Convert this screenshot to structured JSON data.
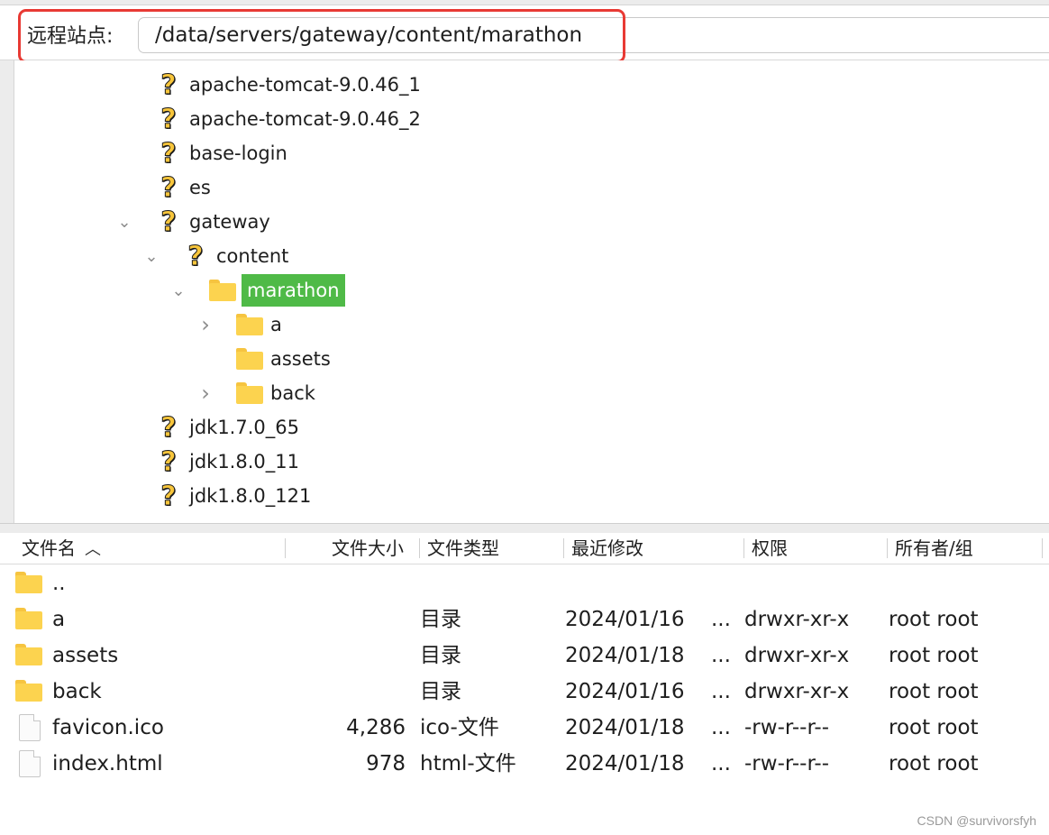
{
  "site_bar": {
    "label": "远程站点:",
    "path": "/data/servers/gateway/content/marathon"
  },
  "tree": [
    {
      "label": "apache-tomcat-9.0.46_1",
      "icon": "question-icon",
      "depth": 0,
      "twisty": ""
    },
    {
      "label": "apache-tomcat-9.0.46_2",
      "icon": "question-icon",
      "depth": 0,
      "twisty": ""
    },
    {
      "label": "base-login",
      "icon": "question-icon",
      "depth": 0,
      "twisty": ""
    },
    {
      "label": "es",
      "icon": "question-icon",
      "depth": 0,
      "twisty": ""
    },
    {
      "label": "gateway",
      "icon": "question-icon",
      "depth": 0,
      "twisty": "expanded"
    },
    {
      "label": "content",
      "icon": "question-icon",
      "depth": 1,
      "twisty": "expanded"
    },
    {
      "label": "marathon",
      "icon": "folder-icon",
      "depth": 2,
      "twisty": "expanded",
      "selected": true
    },
    {
      "label": "a",
      "icon": "folder-icon",
      "depth": 3,
      "twisty": "collapsed"
    },
    {
      "label": "assets",
      "icon": "folder-icon",
      "depth": 3,
      "twisty": ""
    },
    {
      "label": "back",
      "icon": "folder-icon",
      "depth": 3,
      "twisty": "collapsed"
    },
    {
      "label": "jdk1.7.0_65",
      "icon": "question-icon",
      "depth": 0,
      "twisty": ""
    },
    {
      "label": "jdk1.8.0_11",
      "icon": "question-icon",
      "depth": 0,
      "twisty": ""
    },
    {
      "label": "jdk1.8.0_121",
      "icon": "question-icon",
      "depth": 0,
      "twisty": ""
    }
  ],
  "columns": {
    "name": "文件名",
    "size": "文件大小",
    "type": "文件类型",
    "modified": "最近修改",
    "perms": "权限",
    "owner": "所有者/组"
  },
  "files": [
    {
      "name": "..",
      "size": "",
      "type": "",
      "modified": "",
      "more": "",
      "perms": "",
      "owner": "",
      "icon": "folder-icon"
    },
    {
      "name": "a",
      "size": "",
      "type": "目录",
      "modified": "2024/01/16",
      "more": "...",
      "perms": "drwxr-xr-x",
      "owner": "root root",
      "icon": "folder-icon"
    },
    {
      "name": "assets",
      "size": "",
      "type": "目录",
      "modified": "2024/01/18",
      "more": "...",
      "perms": "drwxr-xr-x",
      "owner": "root root",
      "icon": "folder-icon"
    },
    {
      "name": "back",
      "size": "",
      "type": "目录",
      "modified": "2024/01/16",
      "more": "...",
      "perms": "drwxr-xr-x",
      "owner": "root root",
      "icon": "folder-icon"
    },
    {
      "name": "favicon.ico",
      "size": "4,286",
      "type": "ico-文件",
      "modified": "2024/01/18",
      "more": "...",
      "perms": "-rw-r--r--",
      "owner": "root root",
      "icon": "file-icon"
    },
    {
      "name": "index.html",
      "size": "978",
      "type": "html-文件",
      "modified": "2024/01/18",
      "more": "...",
      "perms": "-rw-r--r--",
      "owner": "root root",
      "icon": "file-icon"
    }
  ],
  "watermark": "CSDN @survivorsfyh",
  "colors": {
    "selection": "#4fba47",
    "highlight_box": "#e83a34",
    "folder": "#fcd34f"
  }
}
